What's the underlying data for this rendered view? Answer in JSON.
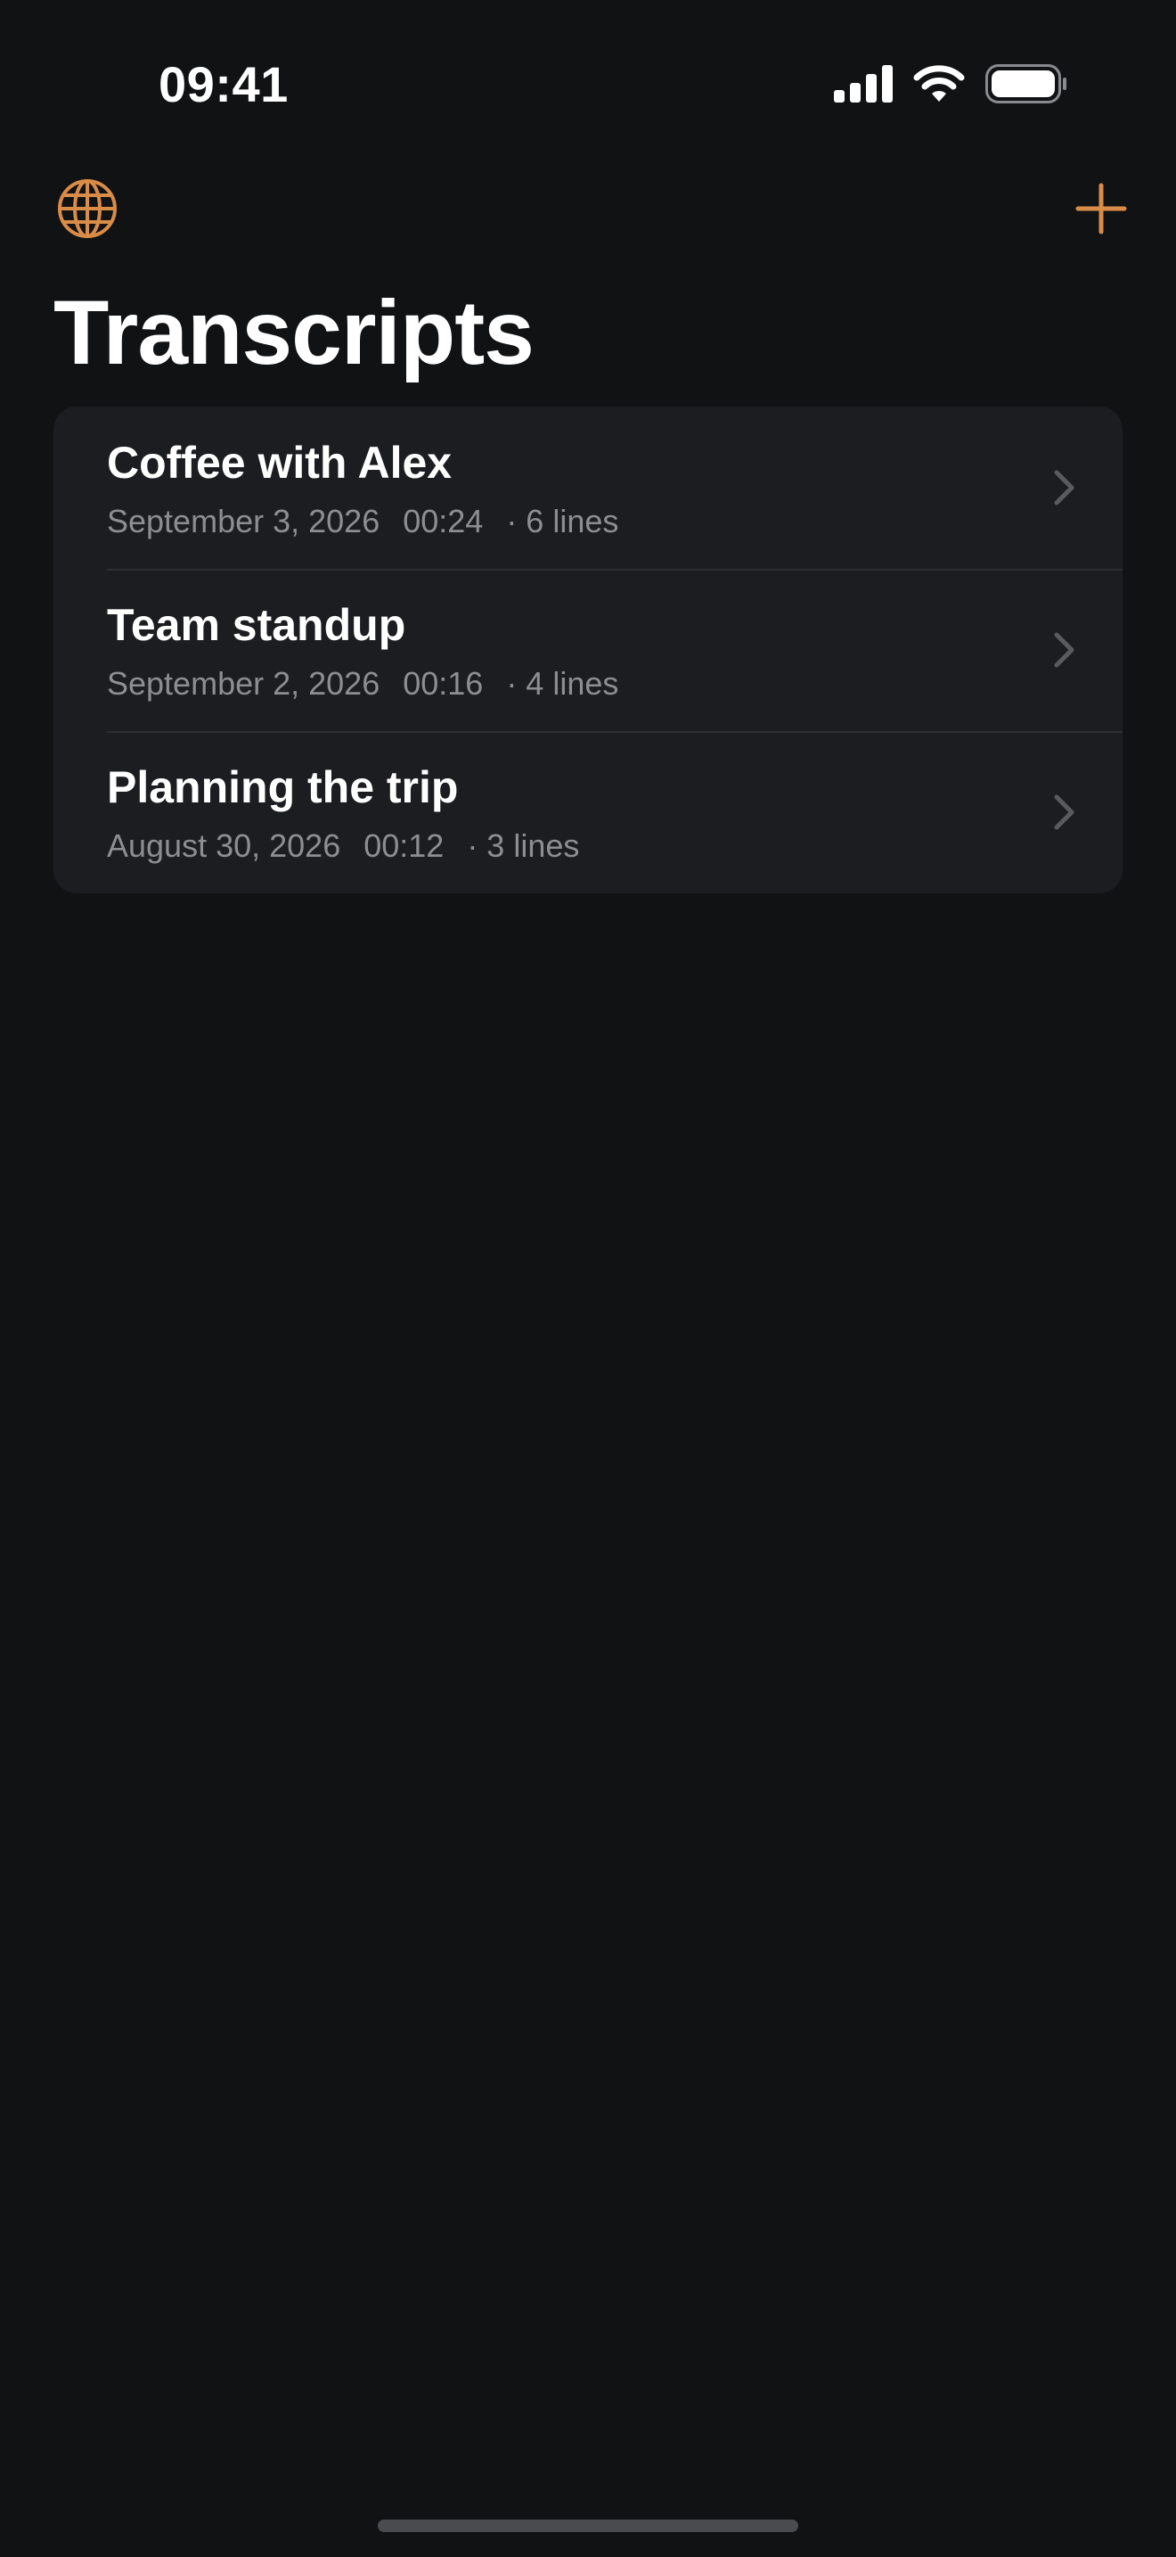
{
  "status_bar": {
    "time": "09:41",
    "icons": [
      "cellular-signal-icon",
      "wifi-icon",
      "battery-icon"
    ]
  },
  "nav": {
    "left_icon": "globe-icon",
    "right_icon": "plus-icon"
  },
  "colors": {
    "accent": "#d98c47",
    "background": "#111214",
    "card": "#1c1d20",
    "secondary_text": "#8d8e93",
    "chevron": "#5a5b60"
  },
  "page": {
    "title": "Transcripts"
  },
  "transcripts": [
    {
      "title": "Coffee with Alex",
      "date": "September 3, 2026",
      "duration": "00:24",
      "lines": "· 6 lines"
    },
    {
      "title": "Team standup",
      "date": "September 2, 2026",
      "duration": "00:16",
      "lines": "· 4 lines"
    },
    {
      "title": "Planning the trip",
      "date": "August 30, 2026",
      "duration": "00:12",
      "lines": "· 3 lines"
    }
  ]
}
